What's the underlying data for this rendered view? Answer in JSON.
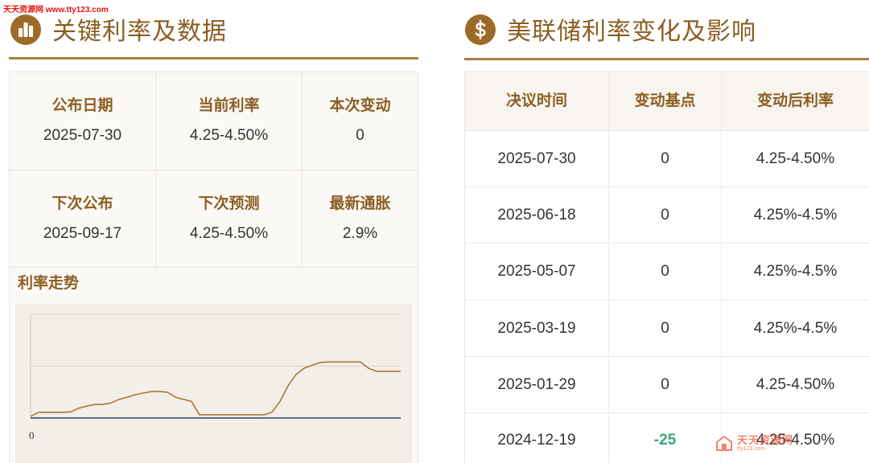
{
  "watermark": {
    "top_text": "天天资源网 www.tty123.com",
    "bottom_name": "天天资源网",
    "bottom_url": "tty123.com"
  },
  "key_data": {
    "icon": "bar-chart-icon",
    "title": "关键利率及数据",
    "stats": [
      {
        "label": "公布日期",
        "value": "2025-07-30"
      },
      {
        "label": "当前利率",
        "value": "4.25-4.50%"
      },
      {
        "label": "本次变动",
        "value": "0"
      },
      {
        "label": "下次公布",
        "value": "2025-09-17"
      },
      {
        "label": "下次预测",
        "value": "4.25-4.50%"
      },
      {
        "label": "最新通胀",
        "value": "2.9%"
      }
    ],
    "trend_title": "利率走势"
  },
  "fed_changes": {
    "icon": "dollar-icon",
    "title": "美联储利率变化及影响",
    "columns": [
      "决议时间",
      "变动基点",
      "变动后利率"
    ],
    "rows": [
      {
        "date": "2025-07-30",
        "bp": "0",
        "rate": "4.25-4.50%"
      },
      {
        "date": "2025-06-18",
        "bp": "0",
        "rate": "4.25%-4.5%"
      },
      {
        "date": "2025-05-07",
        "bp": "0",
        "rate": "4.25%-4.5%"
      },
      {
        "date": "2025-03-19",
        "bp": "0",
        "rate": "4.25%-4.5%"
      },
      {
        "date": "2025-01-29",
        "bp": "0",
        "rate": "4.25-4.50%"
      },
      {
        "date": "2024-12-19",
        "bp": "-25",
        "rate": "4.25-4.50%"
      }
    ]
  },
  "colors": {
    "accent": "#8b5e22",
    "icon_background": "#9c6b28",
    "negative": "#38a878",
    "series_line": "#a57a37",
    "axis_line": "#2d3b6b",
    "watermark": "#e3130f"
  },
  "chart_data": {
    "type": "line",
    "tick_labels": [
      "0"
    ],
    "ylim": [
      0,
      10
    ],
    "grid": true,
    "series": [
      {
        "values": [
          0.15,
          0.55,
          0.55,
          0.55,
          0.55,
          0.6,
          0.95,
          1.15,
          1.3,
          1.3,
          1.45,
          1.8,
          2.0,
          2.25,
          2.4,
          2.55,
          2.55,
          2.5,
          2.0,
          1.8,
          1.6,
          0.3,
          0.3,
          0.3,
          0.3,
          0.3,
          0.3,
          0.3,
          0.3,
          0.3,
          0.55,
          1.6,
          3.1,
          4.2,
          4.8,
          5.1,
          5.35,
          5.4,
          5.4,
          5.4,
          5.4,
          5.4,
          4.8,
          4.5,
          4.5,
          4.5,
          4.5
        ]
      }
    ]
  }
}
